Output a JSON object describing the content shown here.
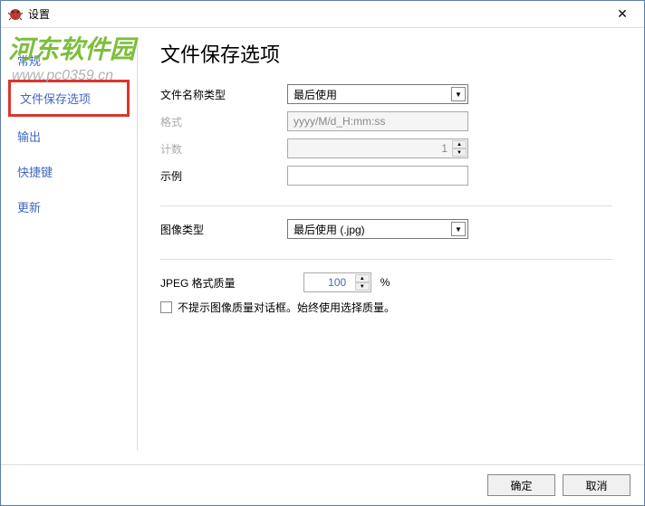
{
  "window": {
    "title": "设置",
    "close_glyph": "✕"
  },
  "watermark": {
    "text": "河东软件园",
    "url": "www.pc0359.cn"
  },
  "sidebar": {
    "items": [
      {
        "label": "常规"
      },
      {
        "label": "文件保存选项"
      },
      {
        "label": "输出"
      },
      {
        "label": "快捷键"
      },
      {
        "label": "更新"
      }
    ]
  },
  "main": {
    "title": "文件保存选项",
    "filename_type_label": "文件名称类型",
    "filename_type_value": "最后使用",
    "format_label": "格式",
    "format_value": "yyyy/M/d_H:mm:ss",
    "count_label": "计数",
    "count_value": "1",
    "example_label": "示例",
    "example_value": "",
    "image_type_label": "图像类型",
    "image_type_value": "最后使用 (.jpg)",
    "jpeg_quality_label": "JPEG 格式质量",
    "jpeg_quality_value": "100",
    "jpeg_percent": "%",
    "checkbox_label": "不提示图像质量对话框。始终使用选择质量。"
  },
  "footer": {
    "ok": "确定",
    "cancel": "取消"
  }
}
